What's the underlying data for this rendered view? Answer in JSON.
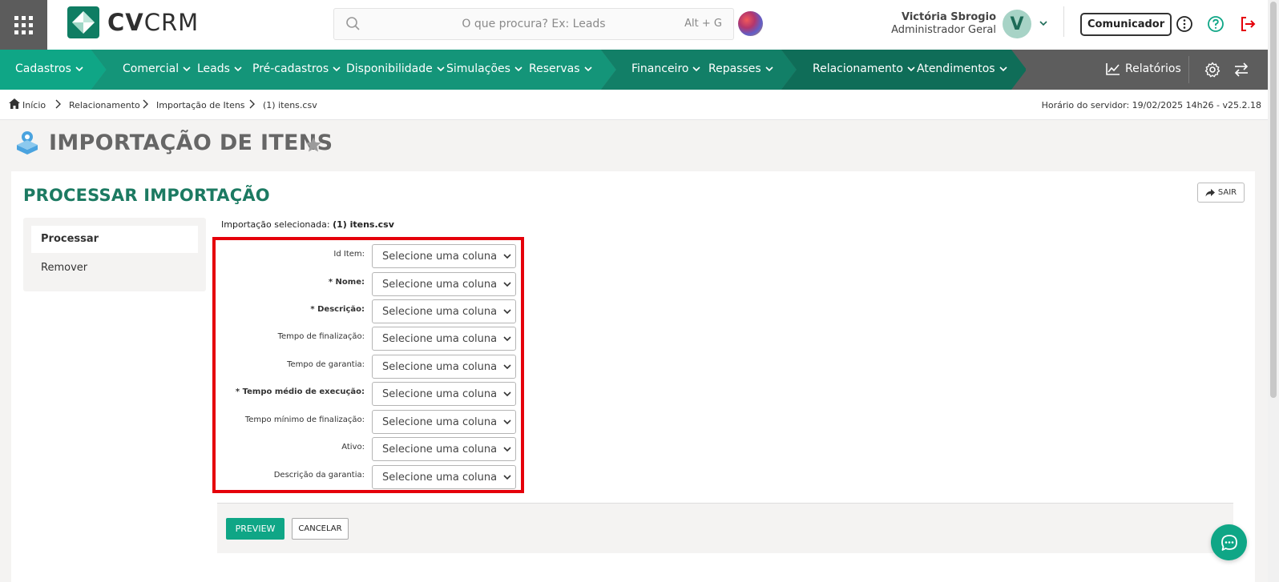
{
  "header": {
    "logo_bold": "CV",
    "logo_light": "CRM",
    "search_placeholder": "O que procura? Ex: Leads",
    "search_shortcut": "Alt + G",
    "user_name": "Victória Sbrogio",
    "user_role": "Administrador Geral",
    "avatar_letter": "V",
    "communicator_label": "Comunicador",
    "colors": {
      "logout_icon": "#e5000a",
      "help_icon": "#0fa686"
    }
  },
  "nav": {
    "items": [
      {
        "label": "Cadastros"
      },
      {
        "label": "Comercial"
      },
      {
        "label": "Leads"
      },
      {
        "label": "Pré-cadastros"
      },
      {
        "label": "Disponibilidade"
      },
      {
        "label": "Simulações"
      },
      {
        "label": "Reservas"
      },
      {
        "label": "Financeiro"
      },
      {
        "label": "Repasses"
      },
      {
        "label": "Relacionamento"
      },
      {
        "label": "Atendimentos"
      }
    ],
    "reports_label": "Relatórios",
    "colors": {
      "segment_1": "#0fa686",
      "segment_2": "#149579",
      "segment_3": "#127f67",
      "segment_4": "#0f6d58",
      "grey": "#5d5d5d"
    }
  },
  "breadcrumb": {
    "items": [
      "Início",
      "Relacionamento",
      "Importação de Itens",
      "(1) itens.csv"
    ],
    "server_time": "Horário do servidor: 19/02/2025 14h26 - v25.2.18"
  },
  "page": {
    "title": "IMPORTAÇÃO DE ITENS"
  },
  "card": {
    "title": "PROCESSAR IMPORTAÇÃO",
    "exit_label": "SAIR",
    "side_menu": [
      {
        "label": "Processar",
        "active": true
      },
      {
        "label": "Remover",
        "active": false
      }
    ],
    "selected_prefix": "Importação selecionada:",
    "selected_file": "(1) itens.csv",
    "fields": [
      {
        "label": "Id Item:",
        "required": false,
        "value": "Selecione uma coluna"
      },
      {
        "label": "* Nome:",
        "required": true,
        "value": "Selecione uma coluna"
      },
      {
        "label": "* Descrição:",
        "required": true,
        "value": "Selecione uma coluna"
      },
      {
        "label": "Tempo de finalização:",
        "required": false,
        "value": "Selecione uma coluna"
      },
      {
        "label": "Tempo de garantia:",
        "required": false,
        "value": "Selecione uma coluna"
      },
      {
        "label": "* Tempo médio de execução:",
        "required": true,
        "value": "Selecione uma coluna"
      },
      {
        "label": "Tempo mínimo de finalização:",
        "required": false,
        "value": "Selecione uma coluna"
      },
      {
        "label": "Ativo:",
        "required": false,
        "value": "Selecione uma coluna"
      },
      {
        "label": "Descrição da garantia:",
        "required": false,
        "value": "Selecione uma coluna"
      }
    ],
    "preview_label": "PREVIEW",
    "cancel_label": "CANCELAR",
    "colors": {
      "title": "#1c7a62",
      "highlight_border": "#e5000a",
      "primary_button": "#0fa686"
    }
  }
}
